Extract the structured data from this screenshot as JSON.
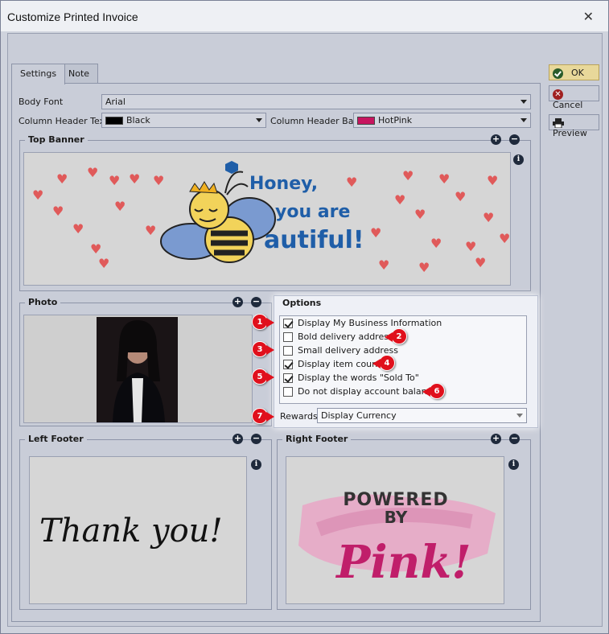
{
  "window": {
    "title": "Customize Printed Invoice",
    "close_icon": "close-icon"
  },
  "tabs": [
    {
      "label": "Settings"
    },
    {
      "label": "Note"
    }
  ],
  "fonts": {
    "body_font_label": "Body Font",
    "body_font_value": "Arial",
    "column_header_text_label": "Column Header Text",
    "column_header_text_value": "Black",
    "column_header_text_color": "#000000",
    "column_header_back_label": "Column Header Back",
    "column_header_back_value": "HotPink",
    "column_header_back_color": "#c7155f"
  },
  "top_banner": {
    "title": "Top Banner",
    "line1": "Honey,",
    "line2": "you are",
    "line3": "autiful!"
  },
  "photo": {
    "title": "Photo"
  },
  "options": {
    "title": "Options",
    "items": [
      {
        "label": "Display My Business Information",
        "checked": true,
        "badge": "1"
      },
      {
        "label": "Bold delivery address",
        "checked": false,
        "badge": "2"
      },
      {
        "label": "Small delivery address",
        "checked": false,
        "badge": "3"
      },
      {
        "label": "Display item count",
        "checked": true,
        "badge": "4"
      },
      {
        "label": "Display the words \"Sold To\"",
        "checked": true,
        "badge": "5"
      },
      {
        "label": "Do not display account balance",
        "checked": false,
        "badge": "6"
      }
    ],
    "rewards_label": "Rewards",
    "rewards_value": "Display Currency",
    "rewards_badge": "7"
  },
  "left_footer": {
    "title": "Left Footer",
    "text": "Thank you!"
  },
  "right_footer": {
    "title": "Right Footer",
    "line1": "POWERED",
    "line2": "BY",
    "line3": "Pink!"
  },
  "buttons": {
    "ok": "OK",
    "cancel": "Cancel",
    "preview": "Preview"
  }
}
